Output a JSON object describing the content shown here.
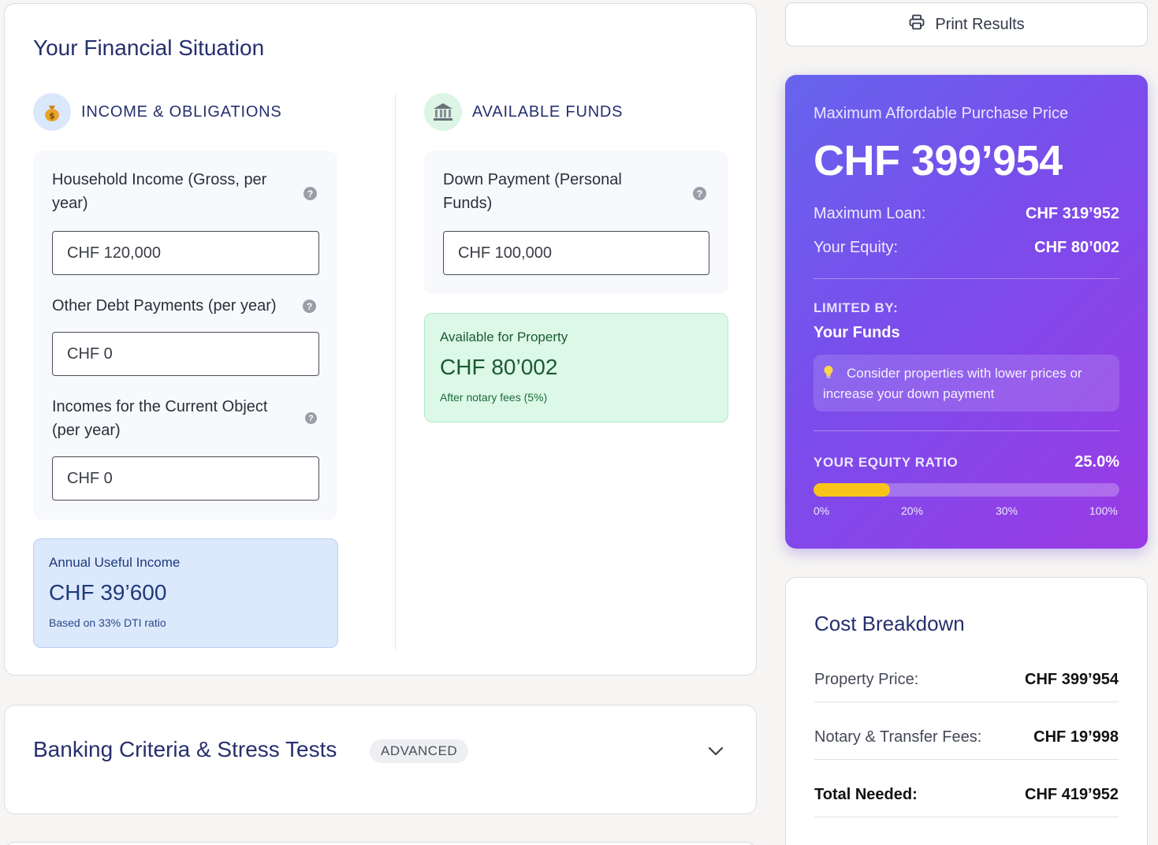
{
  "financial": {
    "title": "Your Financial Situation",
    "income_section": {
      "icon": "money-bag-icon",
      "label": "INCOME & OBLIGATIONS",
      "fields": [
        {
          "label": "Household Income (Gross, per year)",
          "value": "CHF 120,000"
        },
        {
          "label": "Other Debt Payments (per year)",
          "value": "CHF 0"
        },
        {
          "label": "Incomes for the Current Object (per year)",
          "value": "CHF 0"
        }
      ],
      "summary": {
        "label": "Annual Useful Income",
        "value": "CHF 39’600",
        "note": "Based on 33% DTI ratio"
      }
    },
    "funds_section": {
      "icon": "bank-icon",
      "label": "AVAILABLE FUNDS",
      "fields": [
        {
          "label": "Down Payment (Personal Funds)",
          "value": "CHF 100,000"
        }
      ],
      "summary": {
        "label": "Available for Property",
        "value": "CHF 80’002",
        "note": "After notary fees (5%)"
      }
    }
  },
  "banking": {
    "title": "Banking Criteria & Stress Tests",
    "badge": "ADVANCED"
  },
  "print": {
    "label": "Print Results"
  },
  "result": {
    "caption": "Maximum Affordable Purchase Price",
    "price": "CHF 399’954",
    "rows": [
      {
        "label": "Maximum Loan:",
        "value": "CHF 319’952"
      },
      {
        "label": "Your Equity:",
        "value": "CHF 80’002"
      }
    ],
    "limited_caption": "LIMITED BY:",
    "limited_value": "Your Funds",
    "tip": "Consider properties with lower prices or increase your down payment",
    "equity_caption": "YOUR EQUITY RATIO",
    "equity_value": "25.0%",
    "equity_fill_fraction": 0.25,
    "ticks": [
      "0%",
      "20%",
      "30%",
      "100%"
    ],
    "colors": {
      "bar_fill": "#f9c41a",
      "gradient_start": "#6664ee",
      "gradient_end": "#9b3ae4"
    }
  },
  "cost": {
    "title": "Cost Breakdown",
    "rows": [
      {
        "label": "Property Price:",
        "value": "CHF 399’954"
      },
      {
        "label": "Notary & Transfer Fees:",
        "value": "CHF 19’998"
      },
      {
        "label": "Total Needed:",
        "value": "CHF 419’952"
      }
    ]
  }
}
